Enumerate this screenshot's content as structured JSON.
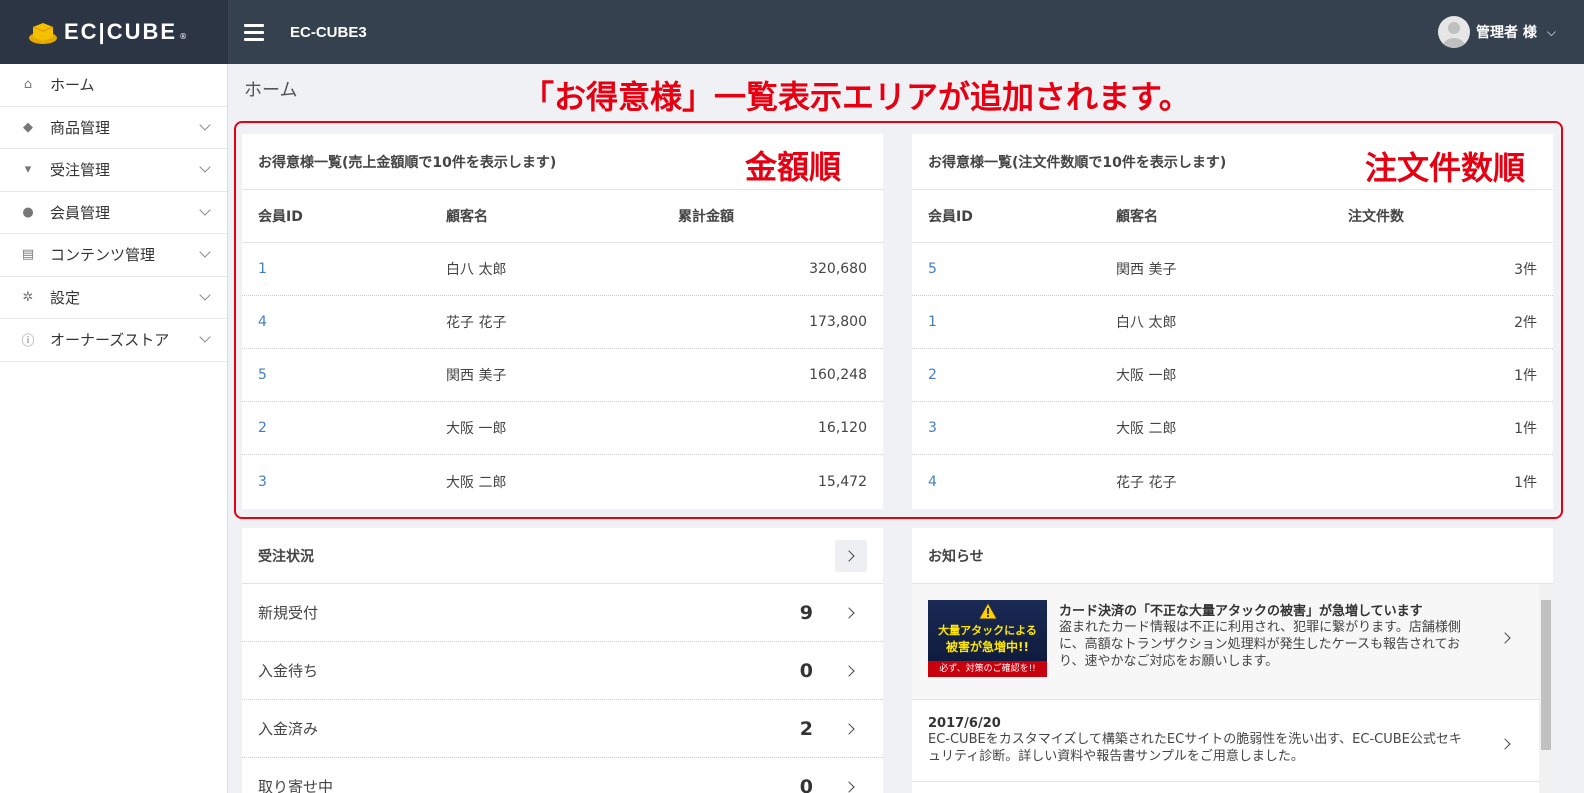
{
  "header": {
    "logo_text": "EC|CUBE",
    "logo_reg": "®",
    "site_name": "EC-CUBE3",
    "user_name": "管理者 様",
    "chevron": "⌵"
  },
  "sidebar": {
    "items": [
      {
        "label": "ホーム",
        "icon": "home-icon",
        "glyph": "⌂"
      },
      {
        "label": "商品管理",
        "icon": "tag-icon",
        "glyph": "◆"
      },
      {
        "label": "受注管理",
        "icon": "cart-icon",
        "glyph": "▾"
      },
      {
        "label": "会員管理",
        "icon": "users-icon",
        "glyph": "●"
      },
      {
        "label": "コンテンツ管理",
        "icon": "document-icon",
        "glyph": "▤"
      },
      {
        "label": "設定",
        "icon": "gear-icon",
        "glyph": "✲"
      },
      {
        "label": "オーナーズストア",
        "icon": "info-icon",
        "glyph": "ⓘ"
      }
    ]
  },
  "page": {
    "title": "ホーム",
    "annotation": "「お得意様」一覧表示エリアが追加されます。"
  },
  "sales_card": {
    "title": "お得意様一覧(売上金額順で10件を表示します)",
    "annotation": "金額順",
    "headers": [
      "会員ID",
      "顧客名",
      "累計金額"
    ],
    "rows": [
      {
        "id": "1",
        "name": "白八 太郎",
        "value": "320,680"
      },
      {
        "id": "4",
        "name": "花子 花子",
        "value": "173,800"
      },
      {
        "id": "5",
        "name": "関西 美子",
        "value": "160,248"
      },
      {
        "id": "2",
        "name": "大阪 一郎",
        "value": "16,120"
      },
      {
        "id": "3",
        "name": "大阪 二郎",
        "value": "15,472"
      }
    ]
  },
  "orders_card": {
    "title": "お得意様一覧(注文件数順で10件を表示します)",
    "annotation": "注文件数順",
    "headers": [
      "会員ID",
      "顧客名",
      "注文件数"
    ],
    "rows": [
      {
        "id": "5",
        "name": "関西 美子",
        "value": "3件"
      },
      {
        "id": "1",
        "name": "白八 太郎",
        "value": "2件"
      },
      {
        "id": "2",
        "name": "大阪 一郎",
        "value": "1件"
      },
      {
        "id": "3",
        "name": "大阪 二郎",
        "value": "1件"
      },
      {
        "id": "4",
        "name": "花子 花子",
        "value": "1件"
      }
    ]
  },
  "status_card": {
    "title": "受注状況",
    "rows": [
      {
        "label": "新規受付",
        "count": "9"
      },
      {
        "label": "入金待ち",
        "count": "0"
      },
      {
        "label": "入金済み",
        "count": "2"
      },
      {
        "label": "取り寄せ中",
        "count": "0"
      }
    ]
  },
  "news_card": {
    "title": "お知らせ",
    "items": [
      {
        "title": "カード決済の「不正な大量アタックの被害」が急増しています",
        "body": "盗まれたカード情報は不正に利用され、犯罪に繋がります。店舗様側に、高額なトランザクション処理料が発生したケースも報告されており、速やかなご対応をお願いします。",
        "banner_line1": "大量アタックによる",
        "banner_line2": "被害が急増中!!",
        "banner_line3": "必ず、対策のご確認を!!"
      },
      {
        "date": "2017/6/20",
        "body": "EC-CUBEをカスタマイズして構築されたECサイトの脆弱性を洗い出す、EC-CUBE公式セキュリティ診断。詳しい資料や報告書サンプルをご用意しました。"
      }
    ]
  },
  "colors": {
    "header_bg": "#36414f",
    "accent_red": "#e60012",
    "link_blue": "#437ec4"
  }
}
